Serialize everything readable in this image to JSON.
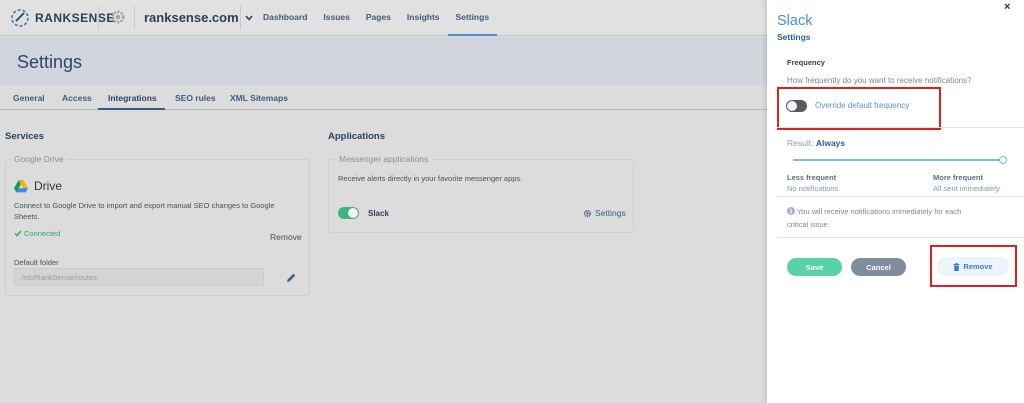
{
  "nav": {
    "brand": "RANKSENSE",
    "domain": "ranksense.com",
    "links": [
      "Dashboard",
      "Issues",
      "Pages",
      "Insights",
      "Settings"
    ]
  },
  "page": {
    "title": "Settings",
    "tabs": [
      "General",
      "Access",
      "Integrations",
      "SEO rules",
      "XML Sitemaps"
    ]
  },
  "services": {
    "title": "Services",
    "card_legend": "Google Drive",
    "name": "Drive",
    "description_line1": "Connect to Google Drive to import and export manual SEO changes to Google",
    "description_line2": "Sheets.",
    "status": "Connected",
    "remove": "Remove",
    "folder_label": "Default folder",
    "folder_value": "/etc/RankSense/routes"
  },
  "applications": {
    "title": "Applications",
    "card_legend": "Messenger applications",
    "description": "Receive alerts directly in your favorite messenger apps.",
    "app_name": "Slack",
    "settings": "Settings"
  },
  "panel": {
    "close": "×",
    "title": "Slack",
    "subtitle": "Settings",
    "frequency_label": "Frequency",
    "frequency_question": "How frequently do you want to receive notifications?",
    "override_label": "Override default frequency",
    "result_label": "Result:",
    "result_value": "Always",
    "slider_level": 1.0,
    "less_title": "Less frequent",
    "less_value": "No notifications",
    "more_title": "More frequent",
    "more_value": "All sent immediately",
    "info_line1": "You will receive notifications immediately for each",
    "info_line2": "critical issue.",
    "save": "Save",
    "cancel": "Cancel",
    "remove": "Remove"
  },
  "colors": {
    "accent": "#4a90e2",
    "success": "#3fb37f",
    "save": "#59d2a6",
    "cancel": "#7f8d9e",
    "highlight": "#e02020"
  }
}
